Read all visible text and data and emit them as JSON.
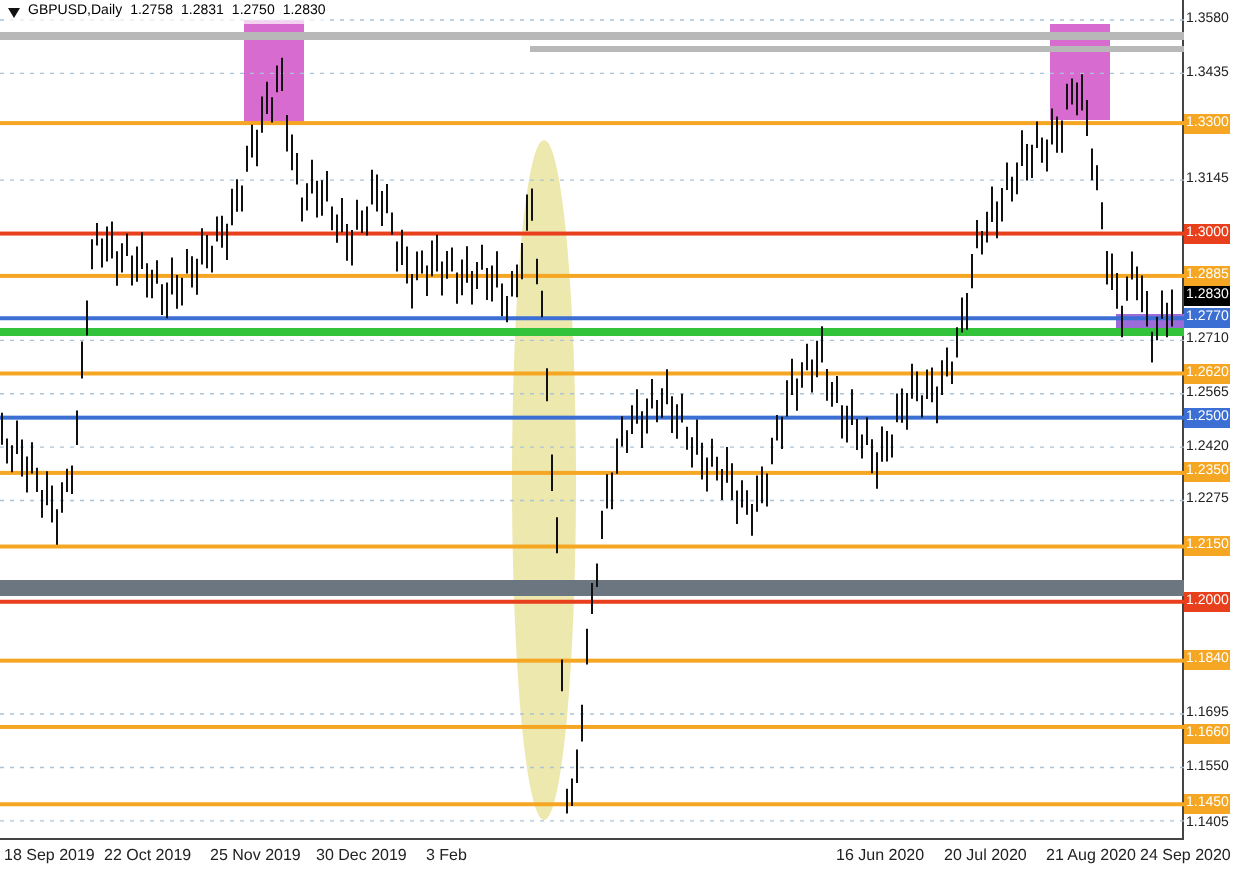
{
  "header": {
    "symbol": "GBPUSD,Daily",
    "quotes": [
      "1.2758",
      "1.2831",
      "1.2750",
      "1.2830"
    ]
  },
  "price_axis": [
    {
      "text": "1.3580",
      "kind": "tick"
    },
    {
      "text": "1.3435",
      "kind": "tick"
    },
    {
      "text": "1.3300",
      "kind": "level",
      "color": "#f5a623"
    },
    {
      "text": "1.3145",
      "kind": "tick"
    },
    {
      "text": "1.3000",
      "kind": "level",
      "color": "#e8401c"
    },
    {
      "text": "1.2885",
      "kind": "level",
      "color": "#f5a623"
    },
    {
      "text": "1.2830",
      "kind": "current"
    },
    {
      "text": "1.2770",
      "kind": "level",
      "color": "#3b6fd4"
    },
    {
      "text": "1.2710",
      "kind": "tick"
    },
    {
      "text": "1.2620",
      "kind": "level",
      "color": "#f5a623"
    },
    {
      "text": "1.2565",
      "kind": "tick"
    },
    {
      "text": "1.2500",
      "kind": "level",
      "color": "#3b6fd4"
    },
    {
      "text": "1.2420",
      "kind": "tick"
    },
    {
      "text": "1.2350",
      "kind": "level",
      "color": "#f5a623"
    },
    {
      "text": "1.2275",
      "kind": "tick"
    },
    {
      "text": "1.2150",
      "kind": "level",
      "color": "#f5a623"
    },
    {
      "text": "1.2000",
      "kind": "level",
      "color": "#e8401c"
    },
    {
      "text": "1.1840",
      "kind": "level",
      "color": "#f5a623"
    },
    {
      "text": "1.1695",
      "kind": "tick"
    },
    {
      "text": "1.1660",
      "kind": "level",
      "color": "#f5a623"
    },
    {
      "text": "1.1550",
      "kind": "tick"
    },
    {
      "text": "1.1450",
      "kind": "level",
      "color": "#f5a623"
    },
    {
      "text": "1.1405",
      "kind": "tick"
    }
  ],
  "time_axis": [
    "18 Sep 2019",
    "22 Oct 2019",
    "25 Nov 2019",
    "30 Dec 2019",
    "3 Feb",
    "16 Jun 2020",
    "20 Jul 2020",
    "21 Aug 2020",
    "24 Sep 2020"
  ]
}
